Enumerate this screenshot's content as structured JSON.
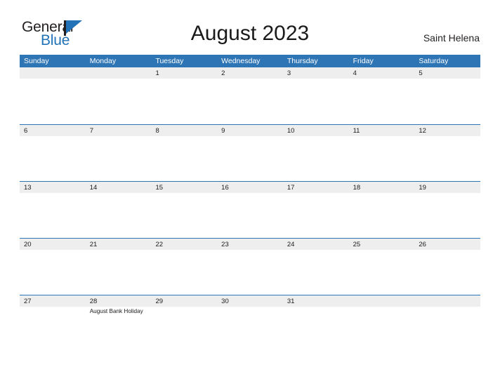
{
  "brand": {
    "name_part1": "General",
    "name_part2": "Blue",
    "flag_icon": "flag-triangle-icon",
    "colors": {
      "dark": "#231f20",
      "blue": "#2272b8"
    }
  },
  "header": {
    "title": "August 2023",
    "location": "Saint Helena"
  },
  "calendar": {
    "accent_color": "#2e75b6",
    "band_color": "#eeeeee",
    "weekdays": [
      "Sunday",
      "Monday",
      "Tuesday",
      "Wednesday",
      "Thursday",
      "Friday",
      "Saturday"
    ],
    "weeks": [
      [
        {
          "day": ""
        },
        {
          "day": ""
        },
        {
          "day": "1"
        },
        {
          "day": "2"
        },
        {
          "day": "3"
        },
        {
          "day": "4"
        },
        {
          "day": "5"
        }
      ],
      [
        {
          "day": "6"
        },
        {
          "day": "7"
        },
        {
          "day": "8"
        },
        {
          "day": "9"
        },
        {
          "day": "10"
        },
        {
          "day": "11"
        },
        {
          "day": "12"
        }
      ],
      [
        {
          "day": "13"
        },
        {
          "day": "14"
        },
        {
          "day": "15"
        },
        {
          "day": "16"
        },
        {
          "day": "17"
        },
        {
          "day": "18"
        },
        {
          "day": "19"
        }
      ],
      [
        {
          "day": "20"
        },
        {
          "day": "21"
        },
        {
          "day": "22"
        },
        {
          "day": "23"
        },
        {
          "day": "24"
        },
        {
          "day": "25"
        },
        {
          "day": "26"
        }
      ],
      [
        {
          "day": "27"
        },
        {
          "day": "28",
          "event": "August Bank Holiday"
        },
        {
          "day": "29"
        },
        {
          "day": "30"
        },
        {
          "day": "31"
        },
        {
          "day": ""
        },
        {
          "day": ""
        }
      ]
    ]
  }
}
